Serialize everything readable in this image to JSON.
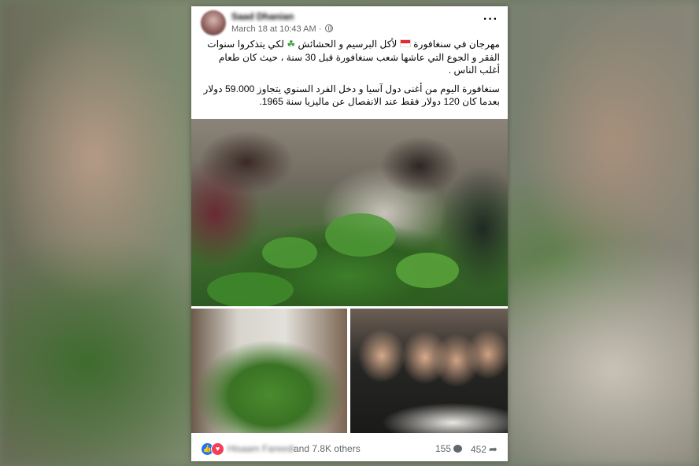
{
  "post": {
    "author": "Saad Dhanian",
    "timestamp": "March 18 at 10:43 AM",
    "separator": "·",
    "paragraph1_a": "مهرجان في سنغافورة",
    "paragraph1_b": "لأكل البرسيم و الحشائش",
    "paragraph1_c": "لكي يتذكروا سنوات الفقر و الجوع التي عاشها شعب سنغافورة قبل 30 سنة ، حيث كان طعام أغلب الناس .",
    "paragraph2": "سنغافورة اليوم من أغنى دول آسيا و دخل الفرد السنوي يتجاوز 59.000 دولار بعدما كان 120 دولار فقط عند الانفصال عن ماليزيا سنة 1965."
  },
  "icons": {
    "more": "more-options-icon",
    "privacy": "globe-icon",
    "flag": "singapore-flag-icon",
    "clover": "shamrock-icon",
    "like": "like-icon",
    "love": "love-icon",
    "comment": "comment-icon",
    "share": "share-icon"
  },
  "reactions": {
    "reactor_name": "Hisaam Fareedi",
    "others_text": "and 7.8K others",
    "comment_count": "155",
    "share_count": "452"
  },
  "colors": {
    "facebook_blue": "#1877f2",
    "love_red": "#f33e58",
    "secondary_text": "#65676b"
  }
}
